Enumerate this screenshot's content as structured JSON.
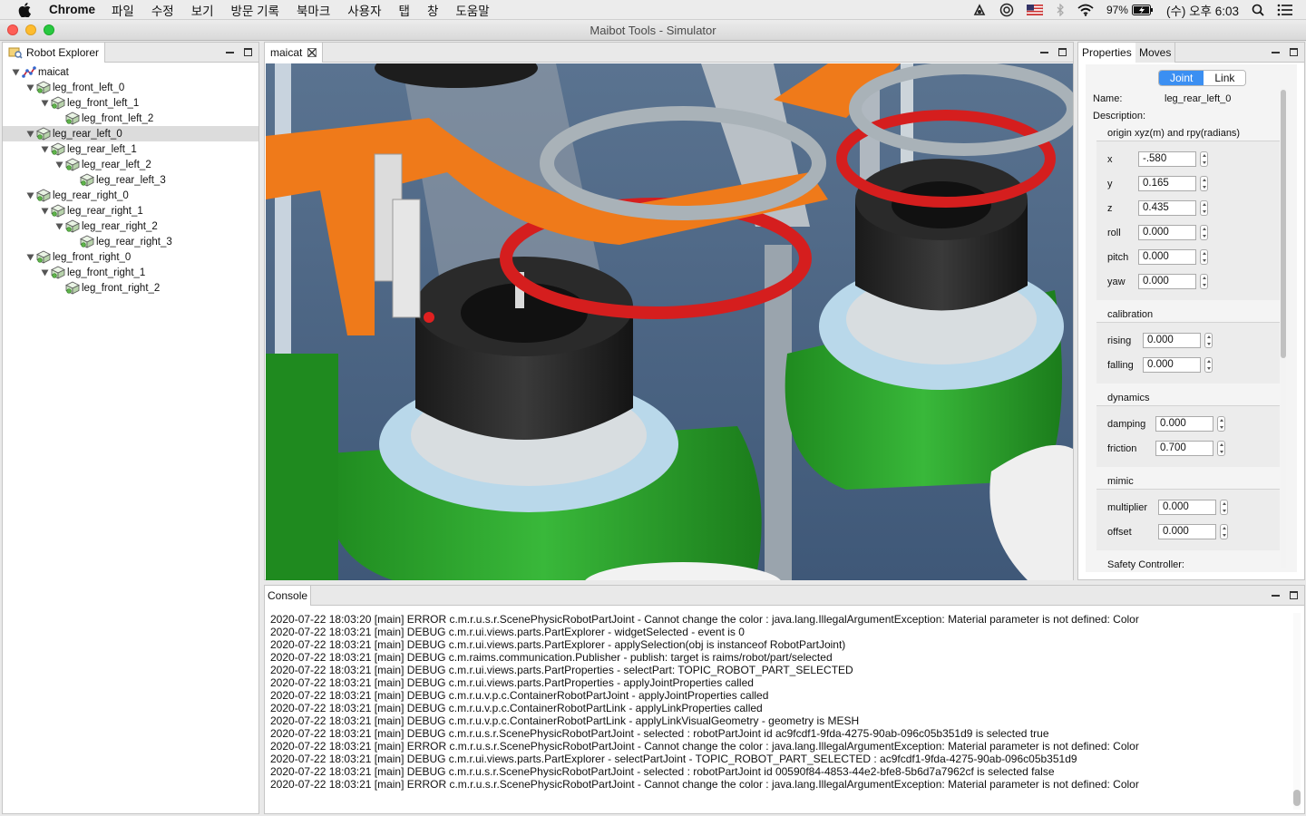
{
  "menubar": {
    "app_name": "Chrome",
    "items": [
      "파일",
      "수정",
      "보기",
      "방문 기록",
      "북마크",
      "사용자",
      "탭",
      "창",
      "도움말"
    ],
    "battery": "97%",
    "datetime": "(수) 오후 6:03"
  },
  "window": {
    "title": "Maibot Tools - Simulator"
  },
  "explorer": {
    "tab_label": "Robot Explorer",
    "nodes": [
      {
        "label": "maicat",
        "depth": 0,
        "expanded": true,
        "selected": false,
        "root": true
      },
      {
        "label": "leg_front_left_0",
        "depth": 1,
        "expanded": true,
        "selected": false
      },
      {
        "label": "leg_front_left_1",
        "depth": 2,
        "expanded": true,
        "selected": false
      },
      {
        "label": "leg_front_left_2",
        "depth": 3,
        "expanded": false,
        "selected": false,
        "leaf": true
      },
      {
        "label": "leg_rear_left_0",
        "depth": 1,
        "expanded": true,
        "selected": true
      },
      {
        "label": "leg_rear_left_1",
        "depth": 2,
        "expanded": true,
        "selected": false
      },
      {
        "label": "leg_rear_left_2",
        "depth": 3,
        "expanded": true,
        "selected": false
      },
      {
        "label": "leg_rear_left_3",
        "depth": 4,
        "expanded": false,
        "selected": false,
        "leaf": true
      },
      {
        "label": "leg_rear_right_0",
        "depth": 1,
        "expanded": true,
        "selected": false
      },
      {
        "label": "leg_rear_right_1",
        "depth": 2,
        "expanded": true,
        "selected": false
      },
      {
        "label": "leg_rear_right_2",
        "depth": 3,
        "expanded": true,
        "selected": false
      },
      {
        "label": "leg_rear_right_3",
        "depth": 4,
        "expanded": false,
        "selected": false,
        "leaf": true
      },
      {
        "label": "leg_front_right_0",
        "depth": 1,
        "expanded": true,
        "selected": false
      },
      {
        "label": "leg_front_right_1",
        "depth": 2,
        "expanded": true,
        "selected": false
      },
      {
        "label": "leg_front_right_2",
        "depth": 3,
        "expanded": false,
        "selected": false,
        "leaf": true
      }
    ]
  },
  "viewport": {
    "tab_label": "maicat"
  },
  "properties": {
    "tabs": [
      "Properties",
      "Moves"
    ],
    "segments": [
      "Joint",
      "Link"
    ],
    "active_segment": "Joint",
    "name_label": "Name:",
    "name_value": "leg_rear_left_0",
    "description_label": "Description:",
    "origin_title": "origin xyz(m) and rpy(radians)",
    "origin": {
      "x_label": "x",
      "x": "-.580",
      "y_label": "y",
      "y": "0.165",
      "z_label": "z",
      "z": "0.435",
      "roll_label": "roll",
      "roll": "0.000",
      "pitch_label": "pitch",
      "pitch": "0.000",
      "yaw_label": "yaw",
      "yaw": "0.000"
    },
    "calibration_title": "calibration",
    "calibration": {
      "rising_label": "rising",
      "rising": "0.000",
      "falling_label": "falling",
      "falling": "0.000"
    },
    "dynamics_title": "dynamics",
    "dynamics": {
      "damping_label": "damping",
      "damping": "0.000",
      "friction_label": "friction",
      "friction": "0.700"
    },
    "mimic_title": "mimic",
    "mimic": {
      "multiplier_label": "multiplier",
      "multiplier": "0.000",
      "offset_label": "offset",
      "offset": "0.000"
    },
    "safety_title": "Safety Controller:"
  },
  "console": {
    "tab_label": "Console",
    "lines": [
      "2020-07-22 18:03:20 [main] ERROR c.m.r.u.s.r.ScenePhysicRobotPartJoint - Cannot change the color : java.lang.IllegalArgumentException: Material parameter is not defined: Color",
      "2020-07-22 18:03:21 [main] DEBUG c.m.r.ui.views.parts.PartExplorer - widgetSelected - event is 0",
      "2020-07-22 18:03:21 [main] DEBUG c.m.r.ui.views.parts.PartExplorer - applySelection(obj is instanceof RobotPartJoint)",
      "2020-07-22 18:03:21 [main] DEBUG c.m.raims.communication.Publisher - publish: target is raims/robot/part/selected",
      "2020-07-22 18:03:21 [main] DEBUG c.m.r.ui.views.parts.PartProperties - selectPart: TOPIC_ROBOT_PART_SELECTED",
      "2020-07-22 18:03:21 [main] DEBUG c.m.r.ui.views.parts.PartProperties - applyJointProperties called",
      "2020-07-22 18:03:21 [main] DEBUG c.m.r.u.v.p.c.ContainerRobotPartJoint - applyJointProperties called",
      "2020-07-22 18:03:21 [main] DEBUG c.m.r.u.v.p.c.ContainerRobotPartLink - applyLinkProperties called",
      "2020-07-22 18:03:21 [main] DEBUG c.m.r.u.v.p.c.ContainerRobotPartLink - applyLinkVisualGeometry - geometry is MESH",
      "2020-07-22 18:03:21 [main] DEBUG c.m.r.u.s.r.ScenePhysicRobotPartJoint - selected : robotPartJoint id ac9fcdf1-9fda-4275-90ab-096c05b351d9 is selected true",
      "2020-07-22 18:03:21 [main] ERROR c.m.r.u.s.r.ScenePhysicRobotPartJoint - Cannot change the color : java.lang.IllegalArgumentException: Material parameter is not defined: Color",
      "2020-07-22 18:03:21 [main] DEBUG c.m.r.ui.views.parts.PartExplorer - selectPartJoint - TOPIC_ROBOT_PART_SELECTED : ac9fcdf1-9fda-4275-90ab-096c05b351d9",
      "2020-07-22 18:03:21 [main] DEBUG c.m.r.u.s.r.ScenePhysicRobotPartJoint - selected : robotPartJoint id 00590f84-4853-44e2-bfe8-5b6d7a7962cf is selected false",
      "2020-07-22 18:03:21 [main] ERROR c.m.r.u.s.r.ScenePhysicRobotPartJoint - Cannot change the color : java.lang.IllegalArgumentException: Material parameter is not defined: Color"
    ]
  },
  "colors": {
    "accent": "#3b8ff2",
    "close": "#fe5f57",
    "minimize": "#febc2e",
    "zoom": "#28c840"
  }
}
